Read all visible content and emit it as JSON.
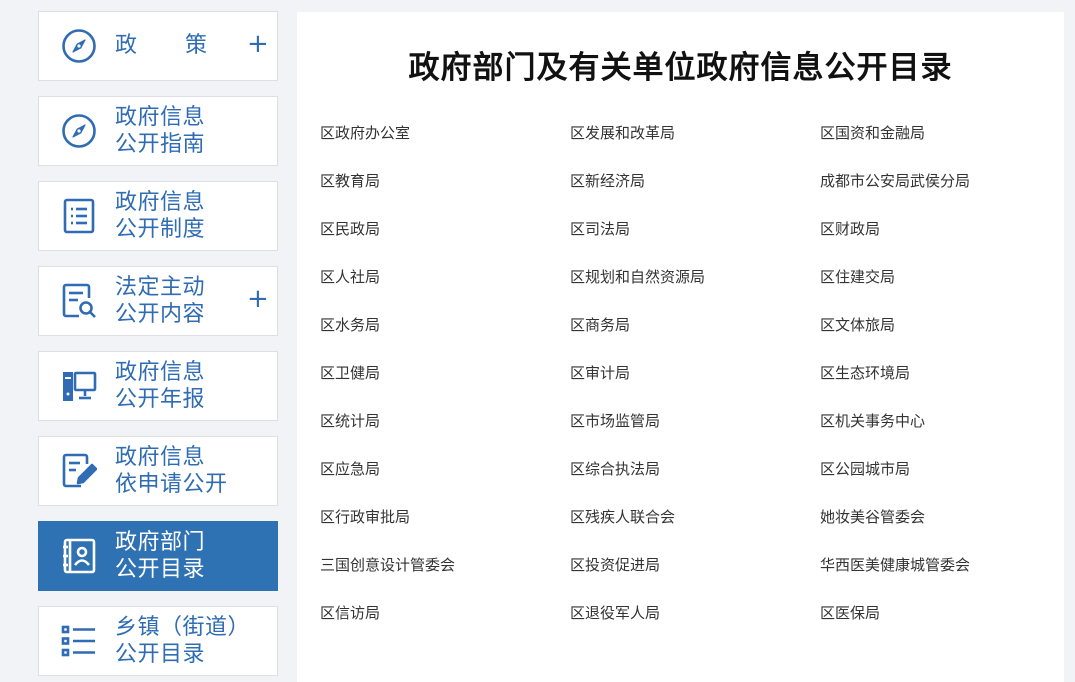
{
  "sidebar": {
    "items": [
      {
        "label": [
          "政",
          "策"
        ],
        "icon": "compass-icon",
        "expandable": true,
        "active": false
      },
      {
        "label": [
          "政府信息",
          "公开指南"
        ],
        "icon": "compass-icon",
        "expandable": false,
        "active": false
      },
      {
        "label": [
          "政府信息",
          "公开制度"
        ],
        "icon": "document-list-icon",
        "expandable": false,
        "active": false
      },
      {
        "label": [
          "法定主动",
          "公开内容"
        ],
        "icon": "document-search-icon",
        "expandable": true,
        "active": false
      },
      {
        "label": [
          "政府信息",
          "公开年报"
        ],
        "icon": "computer-icon",
        "expandable": false,
        "active": false
      },
      {
        "label": [
          "政府信息",
          "依申请公开"
        ],
        "icon": "edit-document-icon",
        "expandable": false,
        "active": false
      },
      {
        "label": [
          "政府部门",
          "公开目录"
        ],
        "icon": "contact-book-icon",
        "expandable": false,
        "active": true
      },
      {
        "label": [
          "乡镇（街道）",
          "公开目录"
        ],
        "icon": "list-icon",
        "expandable": false,
        "active": false
      }
    ],
    "expand_symbol": "+"
  },
  "main": {
    "title": "政府部门及有关单位政府信息公开目录",
    "departments": [
      "区政府办公室",
      "区发展和改革局",
      "区国资和金融局",
      "区教育局",
      "区新经济局",
      "成都市公安局武侯分局",
      "区民政局",
      "区司法局",
      "区财政局",
      "区人社局",
      "区规划和自然资源局",
      "区住建交局",
      "区水务局",
      "区商务局",
      "区文体旅局",
      "区卫健局",
      "区审计局",
      "区生态环境局",
      "区统计局",
      "区市场监管局",
      "区机关事务中心",
      "区应急局",
      "区综合执法局",
      "区公园城市局",
      "区行政审批局",
      "区残疾人联合会",
      "她妆美谷管委会",
      "三国创意设计管委会",
      "区投资促进局",
      "华西医美健康城管委会",
      "区信访局",
      "区退役军人局",
      "区医保局"
    ]
  },
  "colors": {
    "brand_blue": "#2f6cb3",
    "active_bg": "#2f72b4",
    "page_bg": "#f1f3f6",
    "link_text": "#333333"
  }
}
